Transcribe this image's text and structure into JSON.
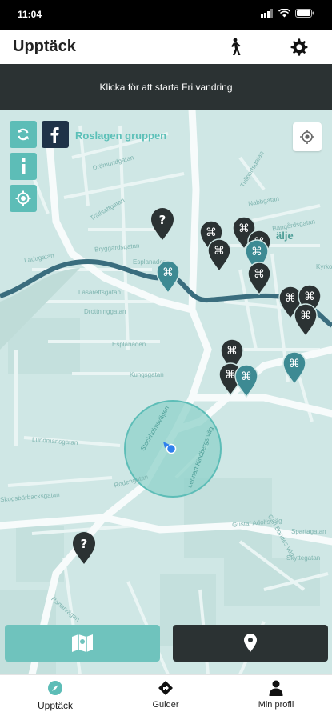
{
  "status_bar": {
    "time": "11:04"
  },
  "header": {
    "title": "Upptäck"
  },
  "banner": {
    "text": "Klicka för att starta Fri vandring"
  },
  "map": {
    "group_label": "Roslagen gruppen",
    "street_labels": {
      "dromund": "Drömundgatan",
      "trallsatt": "Trällsattgatan",
      "laduga": "Ladugatan",
      "bryggard": "Bryggärdsgatan",
      "esplanad": "Esplanaden",
      "esplanaden_h": "Esplanaden",
      "drottning": "Drottninggatan",
      "lasarett": "Lasarettsgatan",
      "kungs": "Kungsgatan",
      "lundmans": "Lundmansgatan",
      "skogs": "Skogsbärbacksgatan",
      "rodenga": "Rodengatan",
      "stolnings": "Stockholmsvägen",
      "stockholmsvag": "Stockholmsvägen",
      "lenacourt": "Lennart Kindbergs väg",
      "gustaf": "Gustaf Adolfs väg",
      "carl": "Carl Bondes väg",
      "sparta": "Spartagatan",
      "skytte": "Skyttegatan",
      "nabb": "Nabbgatan",
      "bangard": "Bangårdsgatan",
      "tullp": "Tullportsgatan",
      "storgatan": "Storgatan",
      "alje": "älje",
      "kyrko": "Kyrko",
      "radarv": "Radarvägen",
      "sodra": "Södra"
    }
  },
  "tabs": [
    {
      "label": "Upptäck",
      "icon": "compass-icon",
      "active": true
    },
    {
      "label": "Guider",
      "icon": "diamond-route-icon",
      "active": false
    },
    {
      "label": "Min profil",
      "icon": "person-icon",
      "active": false
    }
  ],
  "colors": {
    "teal": "#5dbdb7",
    "dark": "#2b3233",
    "water": "#3a6d7e",
    "map_bg": "#cfe7e5",
    "facebook": "#1f3348"
  }
}
